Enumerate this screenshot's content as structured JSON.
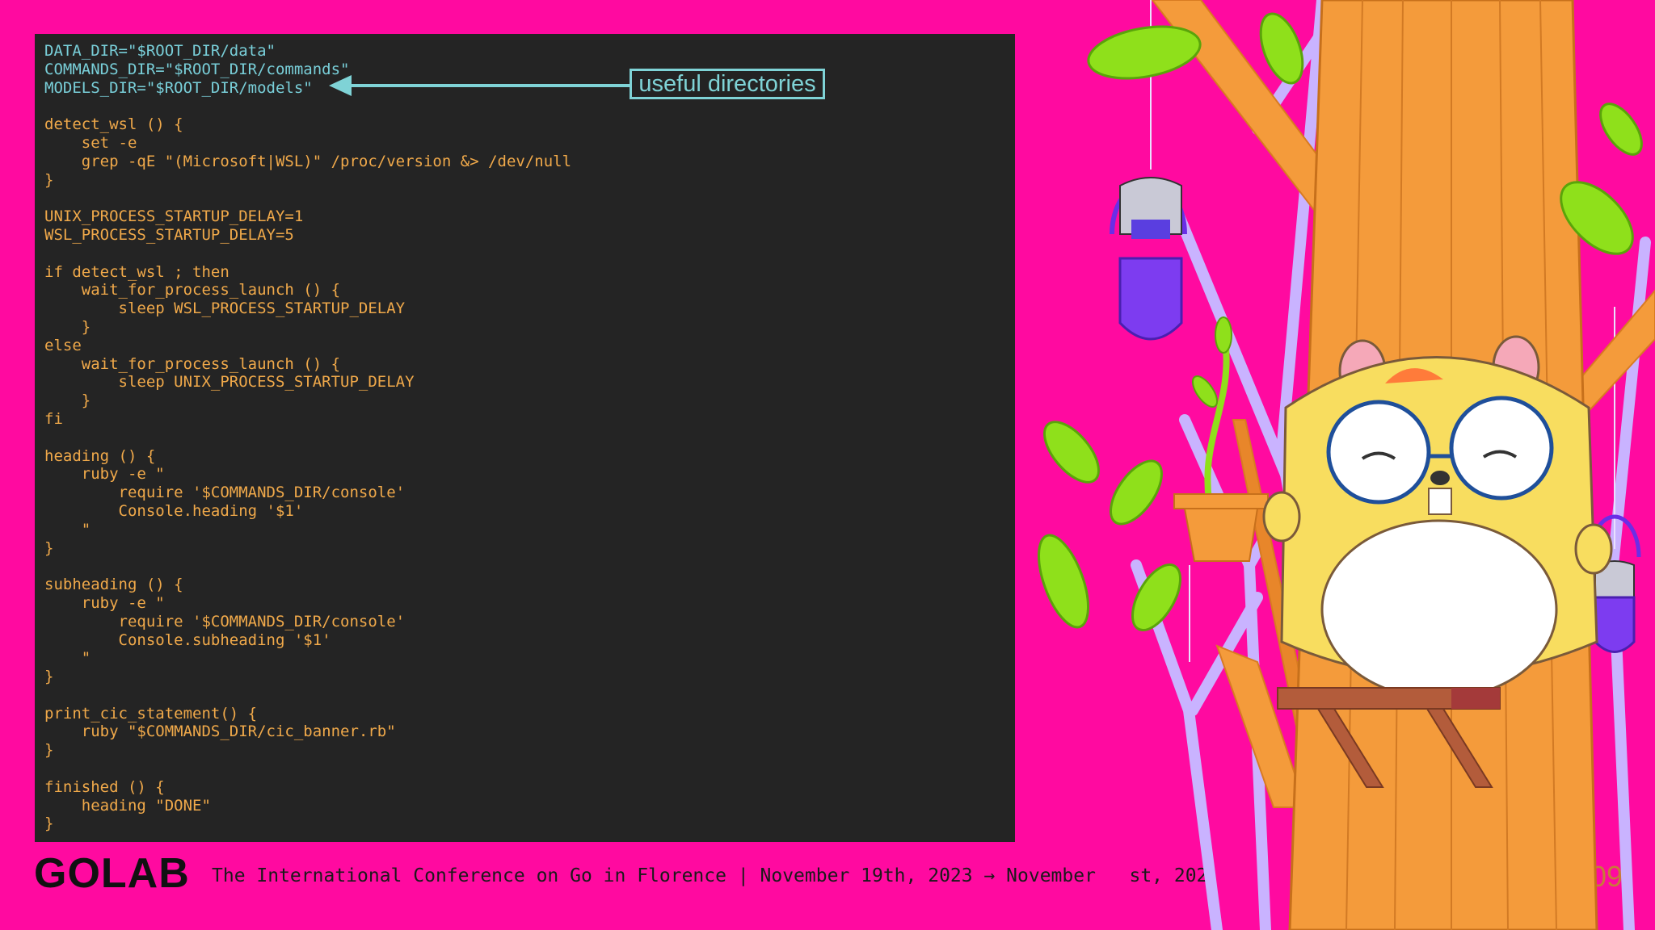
{
  "code": {
    "lines": [
      "DATA_DIR=\"$ROOT_DIR/data\"",
      "COMMANDS_DIR=\"$ROOT_DIR/commands\"",
      "MODELS_DIR=\"$ROOT_DIR/models\"",
      "",
      "detect_wsl () {",
      "    set -e",
      "    grep -qE \"(Microsoft|WSL)\" /proc/version &> /dev/null",
      "}",
      "",
      "UNIX_PROCESS_STARTUP_DELAY=1",
      "WSL_PROCESS_STARTUP_DELAY=5",
      "",
      "if detect_wsl ; then",
      "    wait_for_process_launch () {",
      "        sleep WSL_PROCESS_STARTUP_DELAY",
      "    }",
      "else",
      "    wait_for_process_launch () {",
      "        sleep UNIX_PROCESS_STARTUP_DELAY",
      "    }",
      "fi",
      "",
      "heading () {",
      "    ruby -e \"",
      "        require '$COMMANDS_DIR/console'",
      "        Console.heading '$1'",
      "    \"",
      "}",
      "",
      "subheading () {",
      "    ruby -e \"",
      "        require '$COMMANDS_DIR/console'",
      "        Console.subheading '$1'",
      "    \"",
      "}",
      "",
      "print_cic_statement() {",
      "    ruby \"$COMMANDS_DIR/cic_banner.rb\"",
      "}",
      "",
      "finished () {",
      "    heading \"DONE\"",
      "}"
    ],
    "highlighted_lines": [
      0,
      1,
      2
    ]
  },
  "callout": {
    "label": "useful directories"
  },
  "footer": {
    "logo": "GOLAB",
    "tagline": "The International Conference on Go in Florence | November 19th, 2023 → November   st, 202",
    "slide_number": "109"
  },
  "colors": {
    "background": "#ff0aa0",
    "code_panel": "#242424",
    "code_text": "#f0a94a",
    "code_highlight": "#79cfd9",
    "callout": "#7fd3d6"
  }
}
